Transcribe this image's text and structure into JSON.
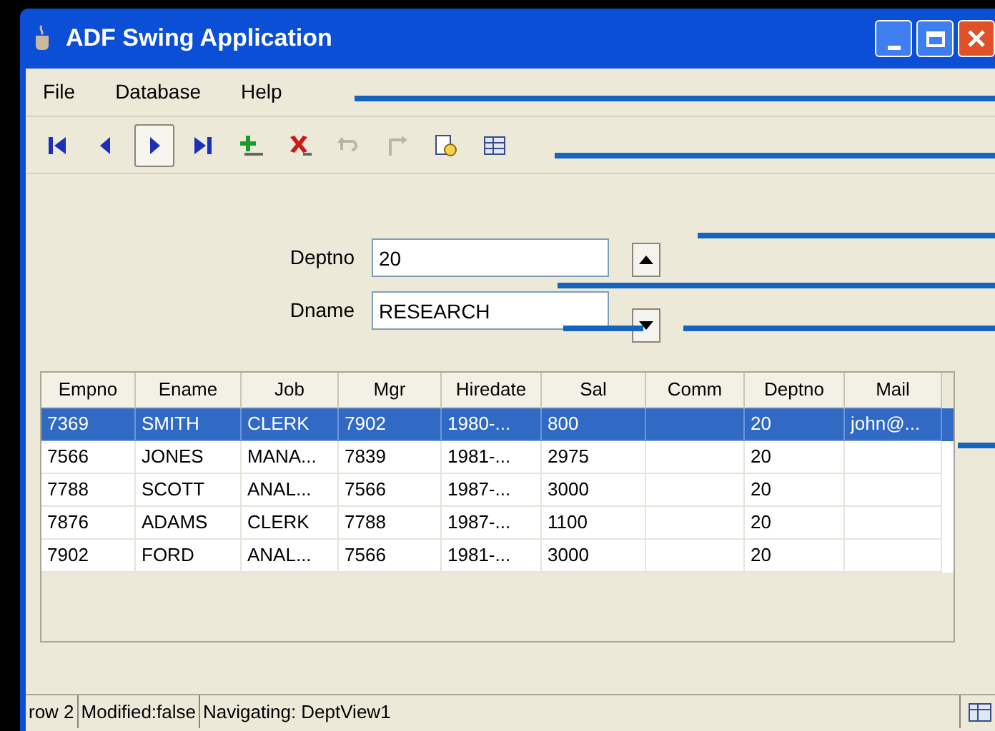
{
  "window": {
    "title": "ADF Swing Application"
  },
  "menu": [
    "File",
    "Database",
    "Help"
  ],
  "toolbar": [
    {
      "kind": "first",
      "disabled": false,
      "selected": false
    },
    {
      "kind": "previous",
      "disabled": false,
      "selected": false
    },
    {
      "kind": "next",
      "disabled": false,
      "selected": true
    },
    {
      "kind": "last",
      "disabled": false,
      "selected": false
    },
    {
      "kind": "insert",
      "disabled": false,
      "selected": false
    },
    {
      "kind": "delete",
      "disabled": false,
      "selected": false
    },
    {
      "kind": "rollback",
      "disabled": true,
      "selected": false
    },
    {
      "kind": "commit",
      "disabled": true,
      "selected": false
    },
    {
      "kind": "find",
      "disabled": false,
      "selected": false
    },
    {
      "kind": "execute",
      "disabled": false,
      "selected": false
    }
  ],
  "form": {
    "fields": [
      {
        "label": "Deptno",
        "value": "20"
      },
      {
        "label": "Dname",
        "value": "RESEARCH"
      }
    ]
  },
  "table": {
    "columns": [
      "Empno",
      "Ename",
      "Job",
      "Mgr",
      "Hiredate",
      "Sal",
      "Comm",
      "Deptno",
      "Mail"
    ],
    "rows": [
      {
        "selected": true,
        "cells": [
          "7369",
          "SMITH",
          "CLERK",
          "7902",
          "1980-...",
          "800",
          "",
          "20",
          "john@..."
        ]
      },
      {
        "selected": false,
        "cells": [
          "7566",
          "JONES",
          "MANA...",
          "7839",
          "1981-...",
          "2975",
          "",
          "20",
          ""
        ]
      },
      {
        "selected": false,
        "cells": [
          "7788",
          "SCOTT",
          "ANAL...",
          "7566",
          "1987-...",
          "3000",
          "",
          "20",
          ""
        ]
      },
      {
        "selected": false,
        "cells": [
          "7876",
          "ADAMS",
          "CLERK",
          "7788",
          "1987-...",
          "1100",
          "",
          "20",
          ""
        ]
      },
      {
        "selected": false,
        "cells": [
          "7902",
          "FORD",
          "ANAL...",
          "7566",
          "1981-...",
          "3000",
          "",
          "20",
          ""
        ]
      }
    ]
  },
  "status_bar": [
    "row 2",
    "Modified:false",
    "Navigating: DeptView1"
  ]
}
